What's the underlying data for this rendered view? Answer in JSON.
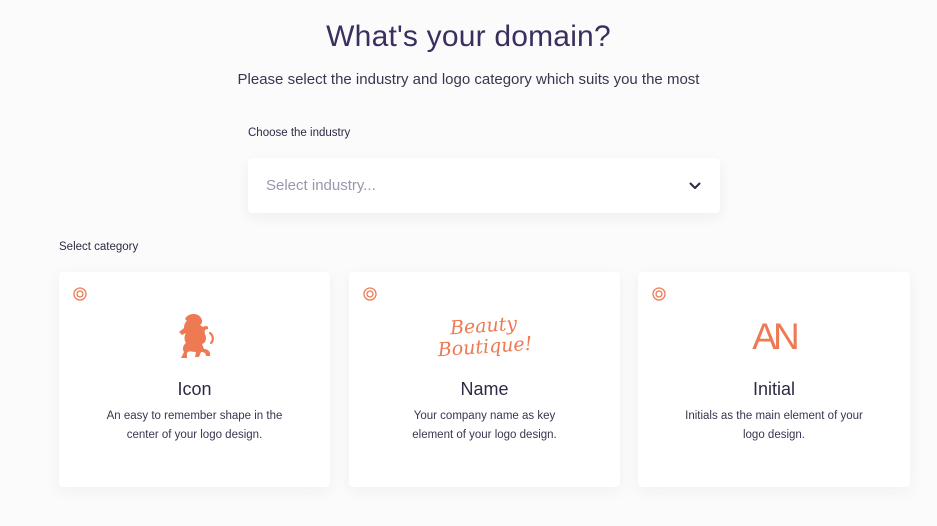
{
  "header": {
    "title": "What's your domain?",
    "subtitle": "Please select the industry and logo category which suits you the most"
  },
  "industry": {
    "label": "Choose the industry",
    "placeholder": "Select industry...",
    "icon": "chevron-down-icon"
  },
  "category": {
    "label": "Select category",
    "cards": [
      {
        "title": "Icon",
        "description": "An easy to remember shape in the center of your logo design.",
        "art": "lion-rampant-icon"
      },
      {
        "title": "Name",
        "description": "Your company name as key element of your logo design.",
        "art_line1": "Beauty",
        "art_line2": "Boutique!"
      },
      {
        "title": "Initial",
        "description": "Initials as the main element of your logo design.",
        "art_text": "AN"
      }
    ]
  },
  "colors": {
    "accent": "#ee7a54",
    "title": "#3a2f5e",
    "text": "#2d2a45",
    "placeholder": "#9a97aa",
    "background": "#fbfbfb"
  }
}
